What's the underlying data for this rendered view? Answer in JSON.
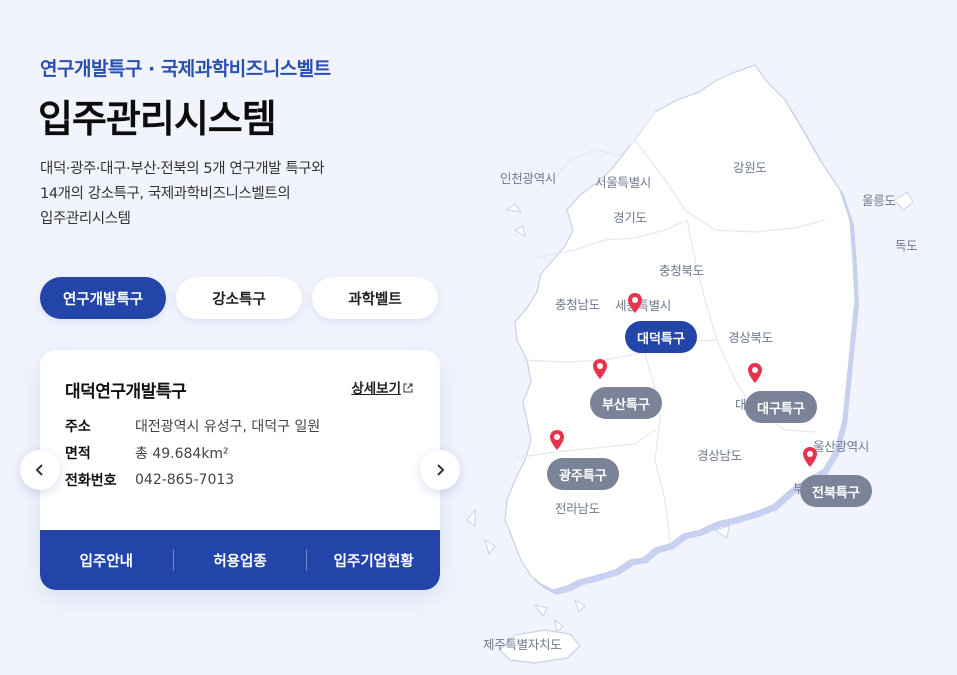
{
  "header": {
    "subtitle": "연구개발특구 · 국제과학비즈니스벨트",
    "title": "입주관리시스템",
    "description": [
      "대덕·광주·대구·부산·전북의 5개 연구개발 특구와",
      "14개의 강소특구, 국제과학비즈니스벨트의",
      "입주관리시스템"
    ]
  },
  "tabs": [
    {
      "label": "연구개발특구",
      "active": true
    },
    {
      "label": "강소특구",
      "active": false
    },
    {
      "label": "과학벨트",
      "active": false
    }
  ],
  "card": {
    "title": "대덕연구개발특구",
    "detail_link": "상세보기",
    "info": [
      {
        "key": "주소",
        "value": "대전광역시 유성구, 대덕구 일원"
      },
      {
        "key": "면적",
        "value": "총 49.684km²"
      },
      {
        "key": "전화번호",
        "value": "042-865-7013"
      }
    ],
    "footer_buttons": [
      "입주안내",
      "허용업종",
      "입주기업현황"
    ]
  },
  "navigation": {
    "prev_icon": "chevron-left-icon",
    "next_icon": "chevron-right-icon"
  },
  "map": {
    "regions": [
      "인천광역시",
      "서울특별시",
      "경기도",
      "강원도",
      "울릉도",
      "독도",
      "충청북도",
      "충청남도",
      "세종특별시",
      "경상북도",
      "대",
      "경상남도",
      "울산광역시",
      "부",
      "전라남도",
      "제주특별자치도"
    ],
    "markers": [
      {
        "label": "대덕특구",
        "active": true
      },
      {
        "label": "부산특구",
        "active": false
      },
      {
        "label": "대구특구",
        "active": false
      },
      {
        "label": "광주특구",
        "active": false
      },
      {
        "label": "전북특구",
        "active": false
      }
    ]
  },
  "colors": {
    "primary": "#2344a9",
    "marker_pin": "#e8334f",
    "marker_inactive": "#7b8399",
    "background": "#f1f4fd"
  }
}
